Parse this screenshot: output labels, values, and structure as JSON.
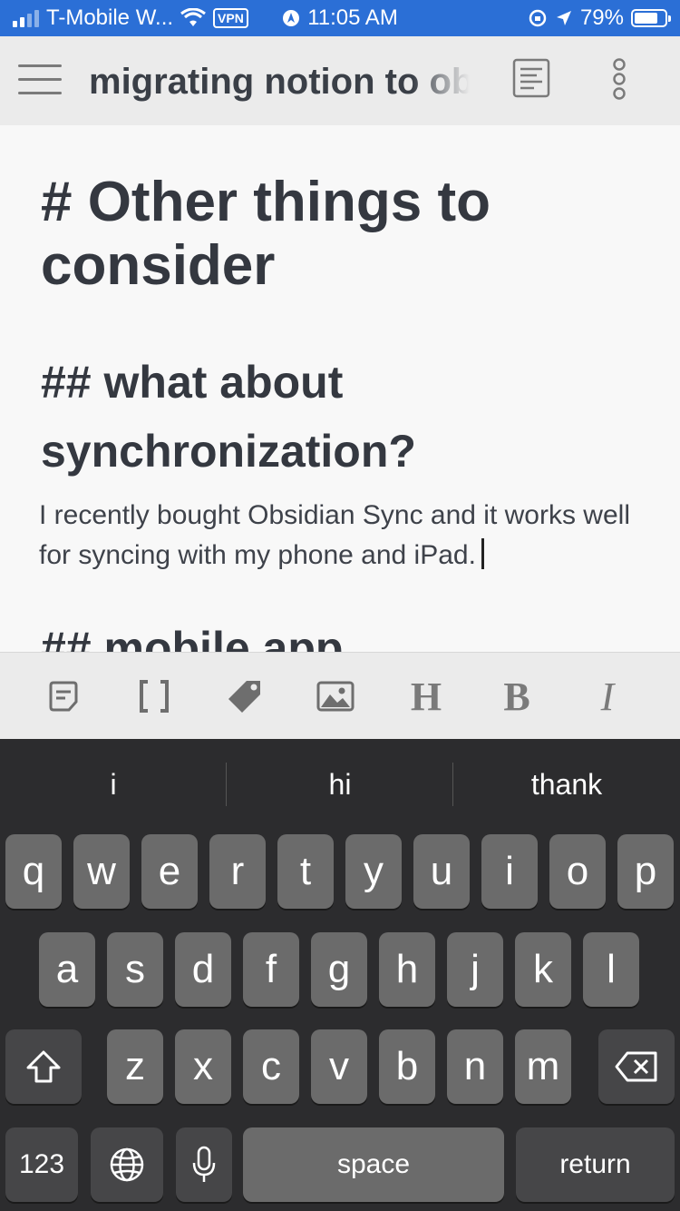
{
  "status_bar": {
    "carrier": "T-Mobile W...",
    "vpn": "VPN",
    "time": "11:05 AM",
    "battery": "79%",
    "battery_level": 0.79,
    "bg_color": "#2b6fd6"
  },
  "app_bar": {
    "title": "migrating notion to ob"
  },
  "note": {
    "heading1": "# Other things to consider",
    "heading2": "## what about synchronization?",
    "paragraph": "I recently bought Obsidian Sync and it works well for syncing with my phone and iPad.",
    "heading2b": "## mobile app"
  },
  "format_toolbar": {
    "heading_label": "H",
    "bold_label": "B",
    "italic_label": "I",
    "icons": [
      "note-icon",
      "brackets-icon",
      "tag-icon",
      "image-icon"
    ]
  },
  "keyboard": {
    "suggestions": [
      "i",
      "hi",
      "thank"
    ],
    "row1": [
      "q",
      "w",
      "e",
      "r",
      "t",
      "y",
      "u",
      "i",
      "o",
      "p"
    ],
    "row2": [
      "a",
      "s",
      "d",
      "f",
      "g",
      "h",
      "j",
      "k",
      "l"
    ],
    "row3": [
      "z",
      "x",
      "c",
      "v",
      "b",
      "n",
      "m"
    ],
    "numbers_label": "123",
    "space_label": "space",
    "return_label": "return"
  }
}
